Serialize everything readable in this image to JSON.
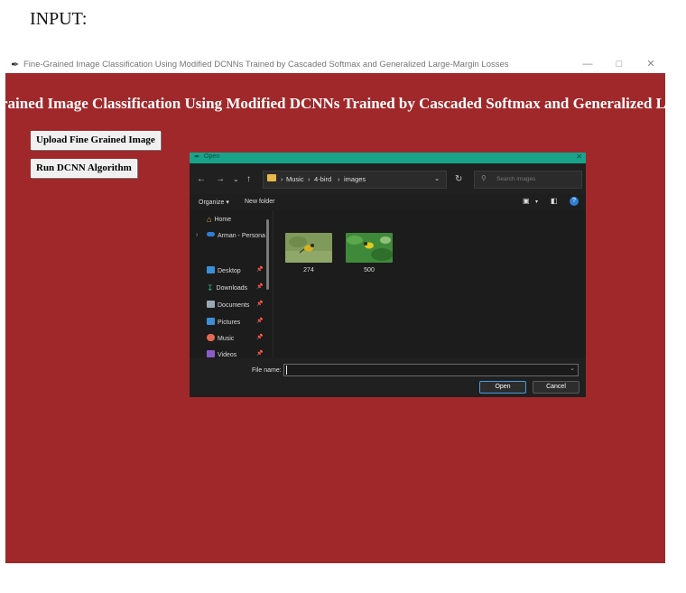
{
  "outer": {
    "label": "INPUT:"
  },
  "app": {
    "window_title": "Fine-Grained Image Classification Using Modified DCNNs Trained by Cascaded Softmax and Generalized Large-Margin Losses",
    "heading": "Fine-Grained Image Classification Using Modified DCNNs Trained by Cascaded Softmax and Generalized Large-Margin Losses",
    "buttons": {
      "upload": "Upload Fine Grained Image",
      "run": "Run DCNN Algorithm"
    },
    "colors": {
      "background": "#a0282a",
      "heading_text": "#ffffff"
    }
  },
  "dialog": {
    "title": "Open",
    "address": {
      "crumbs": [
        "Music",
        "4-bird",
        "images"
      ]
    },
    "search_placeholder": "Search images",
    "toolbar": {
      "organize": "Organize ▾",
      "new_folder": "New folder"
    },
    "nav": [
      {
        "label": "Home",
        "icon": "home-icon"
      },
      {
        "label": "Arman - Persona",
        "icon": "onedrive-icon"
      },
      {
        "label": "Desktop",
        "icon": "desktop-icon"
      },
      {
        "label": "Downloads",
        "icon": "downloads-icon"
      },
      {
        "label": "Documents",
        "icon": "documents-icon"
      },
      {
        "label": "Pictures",
        "icon": "pictures-icon"
      },
      {
        "label": "Music",
        "icon": "music-icon"
      },
      {
        "label": "Videos",
        "icon": "videos-icon"
      }
    ],
    "files": [
      {
        "name": "274"
      },
      {
        "name": "500"
      }
    ],
    "filename": {
      "label": "File name:",
      "value": ""
    },
    "buttons": {
      "open": "Open",
      "cancel": "Cancel"
    },
    "colors": {
      "titlebar": "#18a38a",
      "body": "#1c1c1c"
    }
  }
}
